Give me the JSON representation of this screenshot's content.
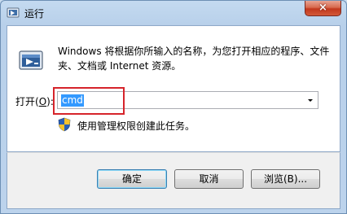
{
  "window": {
    "title": "运行",
    "close_label": "×"
  },
  "dialog": {
    "description": "Windows 将根据你所输入的名称，为您打开相应的程序、文件夹、文档或 Internet 资源。",
    "open_label": "打开(",
    "open_accel": "O",
    "open_label_end": "):",
    "command_value": "cmd",
    "admin_note": "使用管理权限创建此任务。"
  },
  "buttons": {
    "ok": "确定",
    "cancel": "取消",
    "browse": "浏览(B)..."
  },
  "colors": {
    "highlight_box": "#d6242b",
    "selection": "#3399ff"
  }
}
